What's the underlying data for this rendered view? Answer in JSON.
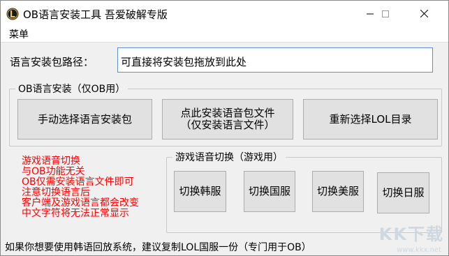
{
  "window": {
    "title": "OB语言安装工具 吾爱破解专版"
  },
  "menu": {
    "label": "菜单"
  },
  "path": {
    "label": "语言安装包路径：",
    "value": "可直接将安装包拖放到此处"
  },
  "install_group": {
    "title": "OB语言安装（仅OB用）",
    "manual_button": "手动选择语言安装包",
    "install_button_line1": "点此安装语音包文件",
    "install_button_line2": "（仅安装语言文件）",
    "reselect_button": "重新选择LOL目录"
  },
  "notes": [
    "游戏语音切换",
    "与OB功能无关",
    "OB仅需安装语言文件即可",
    "注意切换语言后",
    "客户端及游戏语言都会改变",
    "中文字符将无法正常显示"
  ],
  "voice_group": {
    "title": "游戏语音切换（游戏用）",
    "korea": "切换韩服",
    "china": "切换国服",
    "usa": "切换美服",
    "japan": "切换日服"
  },
  "status": {
    "text": "如果你想要使用韩语回放系统，建议复制LOL国服一份（专门用于OB）"
  },
  "watermark": {
    "brand": "KK下载",
    "url": "www.kkx.net"
  },
  "colors": {
    "note_text": "#ff0000",
    "input_border": "#5b8fd6",
    "button_bg": "#e1e1e1"
  }
}
